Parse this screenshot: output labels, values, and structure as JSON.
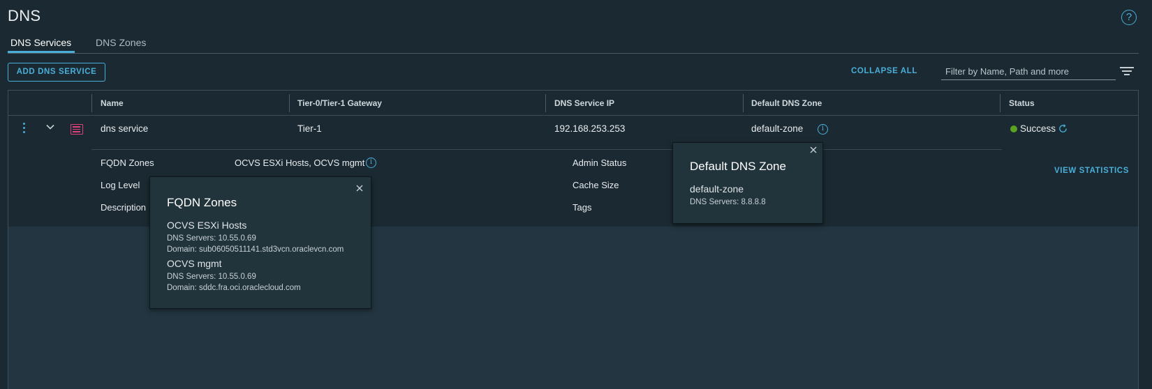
{
  "page": {
    "title": "DNS"
  },
  "tabs": [
    {
      "label": "DNS Services"
    },
    {
      "label": "DNS Zones"
    }
  ],
  "toolbar": {
    "add_label": "ADD DNS SERVICE",
    "collapse_label": "COLLAPSE ALL",
    "filter_placeholder": "Filter by Name, Path and more"
  },
  "table": {
    "columns": [
      "Name",
      "Tier-0/Tier-1 Gateway",
      "DNS Service IP",
      "Default DNS Zone",
      "Status"
    ],
    "rows": [
      {
        "name": "dns service",
        "gateway": "Tier-1",
        "ip": "192.168.253.253",
        "zone": "default-zone",
        "status": "Success"
      }
    ]
  },
  "details": {
    "fqdn_label": "FQDN Zones",
    "fqdn_value": "OCVS ESXi Hosts, OCVS mgmt",
    "log_label": "Log Level",
    "desc_label": "Description",
    "admin_label": "Admin Status",
    "cache_label": "Cache Size",
    "tags_label": "Tags",
    "view_stats": "VIEW STATISTICS"
  },
  "fqdn_popover": {
    "title": "FQDN Zones",
    "zones": [
      {
        "name": "OCVS ESXi Hosts",
        "servers": "DNS Servers: 10.55.0.69",
        "domain": "Domain: sub06050511141.std3vcn.oraclevcn.com"
      },
      {
        "name": "OCVS mgmt",
        "servers": "DNS Servers: 10.55.0.69",
        "domain": "Domain: sddc.fra.oci.oraclecloud.com"
      }
    ]
  },
  "zone_popover": {
    "title": "Default DNS Zone",
    "zone": "default-zone",
    "servers": "DNS Servers: 8.8.8.8"
  },
  "colors": {
    "accent": "#49afd9",
    "success": "#5aa220",
    "background": "#1b2a32",
    "service_icon": "#e0407a"
  }
}
